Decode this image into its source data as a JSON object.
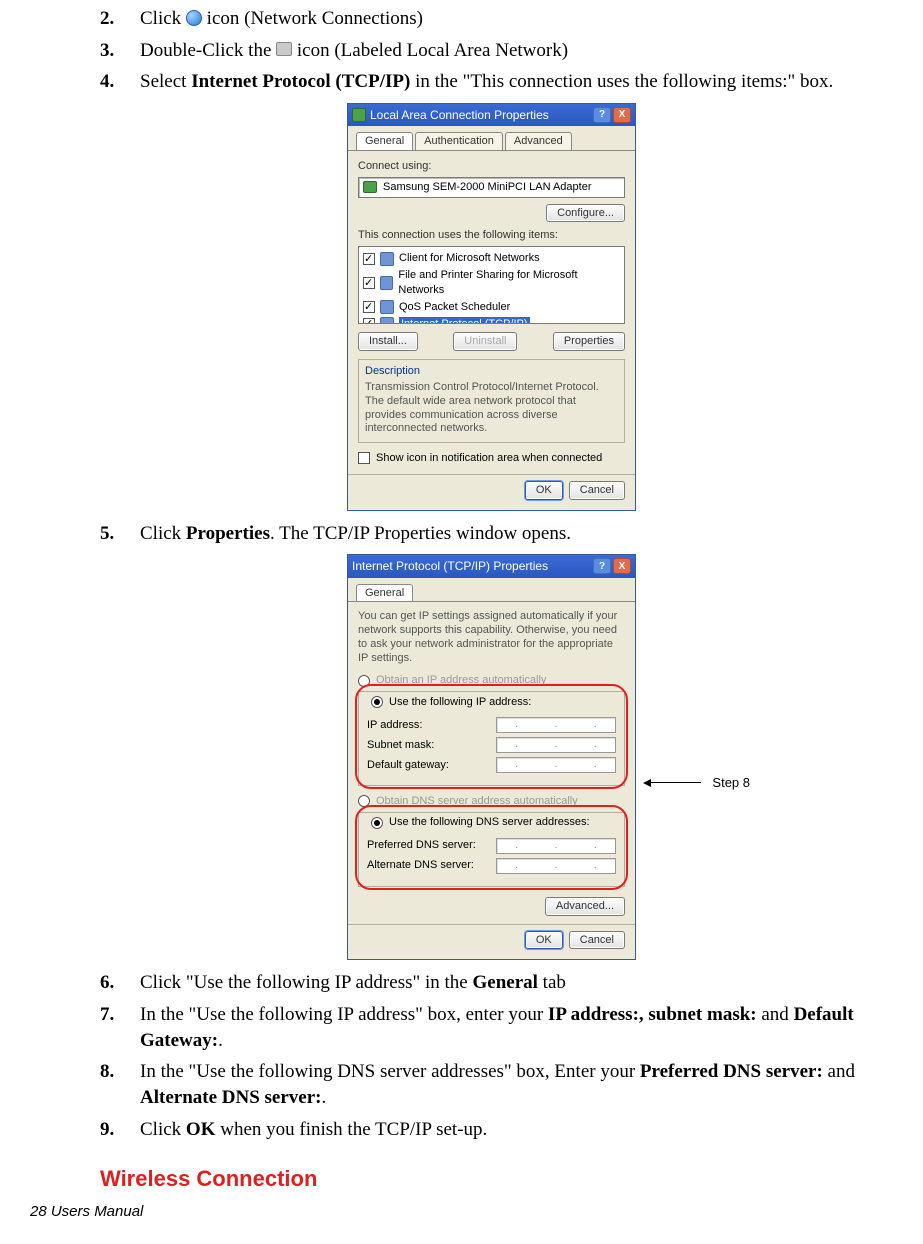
{
  "steps": {
    "s2": {
      "num": "2.",
      "t1": "Click ",
      "t2": " icon (Network Connections)"
    },
    "s3": {
      "num": "3.",
      "t1": "Double-Click the ",
      "t2": " icon (Labeled Local Area Network)"
    },
    "s4": {
      "num": "4.",
      "t1": "Select ",
      "b1": "Internet Protocol (TCP/IP)",
      "t2": " in the \"This connection uses the following items:\" box."
    },
    "s5": {
      "num": "5.",
      "t1": "Click ",
      "b1": "Properties",
      "t2": ". The TCP/IP Properties window opens."
    },
    "s6": {
      "num": "6.",
      "t1": "Click \"Use the following IP address\" in the ",
      "b1": "General",
      "t2": " tab"
    },
    "s7": {
      "num": "7.",
      "t1": "In the \"Use the following IP address\" box, enter your ",
      "b1": "IP address:, subnet mask:",
      "t2": " and ",
      "b2": "Default Gateway:",
      "t3": "."
    },
    "s8": {
      "num": "8.",
      "t1": "In the \"Use the following DNS server addresses\" box, Enter your ",
      "b1": "Preferred DNS server:",
      "t2": " and ",
      "b2": "Alternate DNS server:",
      "t3": "."
    },
    "s9": {
      "num": "9.",
      "t1": "Click ",
      "b1": "OK",
      "t2": " when you finish the TCP/IP set-up."
    }
  },
  "heading_wireless": "Wireless Connection",
  "footer": "28  Users Manual",
  "callout": "Step 8",
  "dialog1": {
    "title": "Local Area Connection Properties",
    "tabs": {
      "general": "General",
      "auth": "Authentication",
      "adv": "Advanced"
    },
    "connect_using_label": "Connect using:",
    "adapter": "Samsung SEM-2000 MiniPCI LAN Adapter",
    "configure_btn": "Configure...",
    "uses_label": "This connection uses the following items:",
    "items": {
      "a": "Client for Microsoft Networks",
      "b": "File and Printer Sharing for Microsoft Networks",
      "c": "QoS Packet Scheduler",
      "d": "Internet Protocol (TCP/IP)"
    },
    "install": "Install...",
    "uninstall": "Uninstall",
    "properties": "Properties",
    "desc_title": "Description",
    "desc": "Transmission Control Protocol/Internet Protocol. The default wide area network protocol that provides communication across diverse interconnected networks.",
    "show_icon": "Show icon in notification area when connected",
    "ok": "OK",
    "cancel": "Cancel"
  },
  "dialog2": {
    "title": "Internet Protocol (TCP/IP) Properties",
    "tab": "General",
    "intro": "You can get IP settings assigned automatically if your network supports this capability. Otherwise, you need to ask your network administrator for the appropriate IP settings.",
    "r_auto_ip": "Obtain an IP address automatically",
    "r_use_ip": "Use the following IP address:",
    "ip": "IP address:",
    "subnet": "Subnet mask:",
    "gateway": "Default gateway:",
    "r_auto_dns": "Obtain DNS server address automatically",
    "r_use_dns": "Use the following DNS server addresses:",
    "pref_dns": "Preferred DNS server:",
    "alt_dns": "Alternate DNS server:",
    "advanced": "Advanced...",
    "ok": "OK",
    "cancel": "Cancel"
  }
}
